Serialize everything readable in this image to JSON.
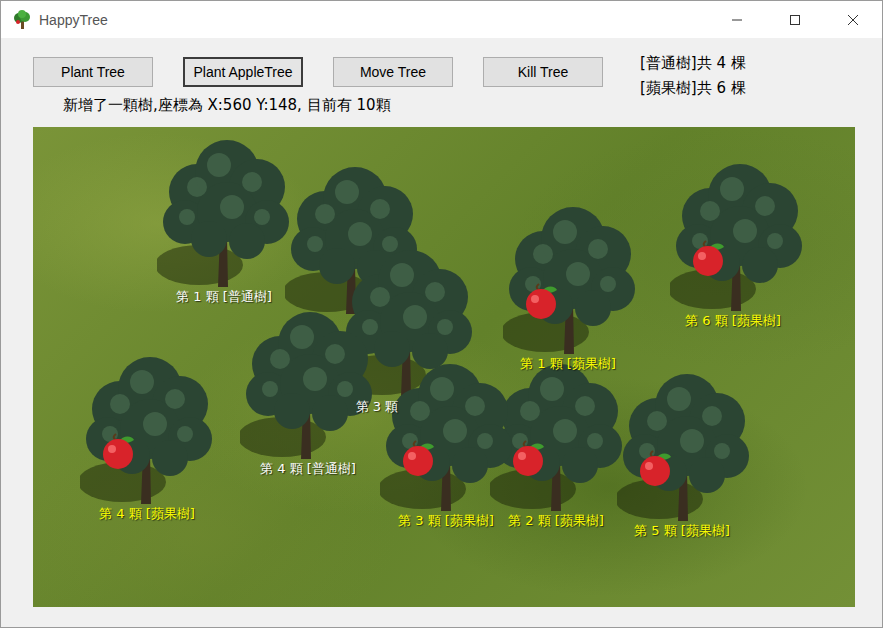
{
  "window": {
    "title": "HappyTree"
  },
  "buttons": [
    {
      "label": "Plant Tree",
      "focused": false
    },
    {
      "label": "Plant AppleTree",
      "focused": true
    },
    {
      "label": "Move Tree",
      "focused": false
    },
    {
      "label": "Kill Tree",
      "focused": false
    }
  ],
  "status": "新增了一顆樹,座標為 X:560 Y:148, 目前有 10顆",
  "counts": [
    "[普通樹]共 4 棵",
    "[蘋果樹]共 6 棵"
  ],
  "trees": [
    {
      "kind": "normal",
      "label": "第 1 顆 [普通樹]"
    },
    {
      "kind": "normal"
    },
    {
      "kind": "normal",
      "label": "第 3 顆"
    },
    {
      "kind": "normal",
      "label": "第 4 顆 [普通樹]"
    },
    {
      "kind": "apple",
      "label": "第 1 顆 [蘋果樹]"
    },
    {
      "kind": "apple",
      "label": "第 2 顆 [蘋果樹]"
    },
    {
      "kind": "apple",
      "label": "第 3 顆 [蘋果樹]"
    },
    {
      "kind": "apple",
      "label": "第 4 顆 [蘋果樹]"
    },
    {
      "kind": "apple",
      "label": "第 5 顆 [蘋果樹]"
    },
    {
      "kind": "apple",
      "label": "第 6 顆 [蘋果樹]"
    }
  ]
}
